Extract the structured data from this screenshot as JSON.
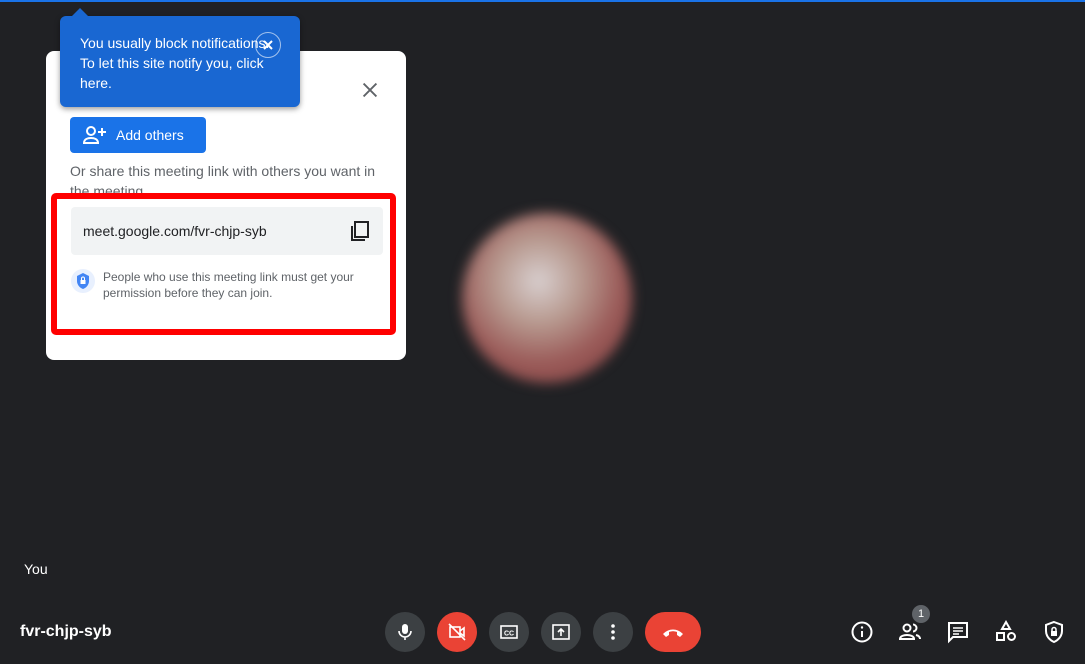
{
  "tooltip": {
    "text": "You usually block notifications. To let this site notify you, click here."
  },
  "dialog": {
    "add_others": "Add others",
    "share_text": "Or share this meeting link with others you want in the meeting",
    "link": "meet.google.com/fvr-chjp-syb",
    "permission": "People who use this meeting link must get your permission before they can join."
  },
  "self_label": "You",
  "meeting_code": "fvr-chjp-syb",
  "participants_count": "1",
  "colors": {
    "background": "#202124",
    "accent": "#1a73e8",
    "danger": "#ea4335",
    "highlight": "#ff0000"
  }
}
